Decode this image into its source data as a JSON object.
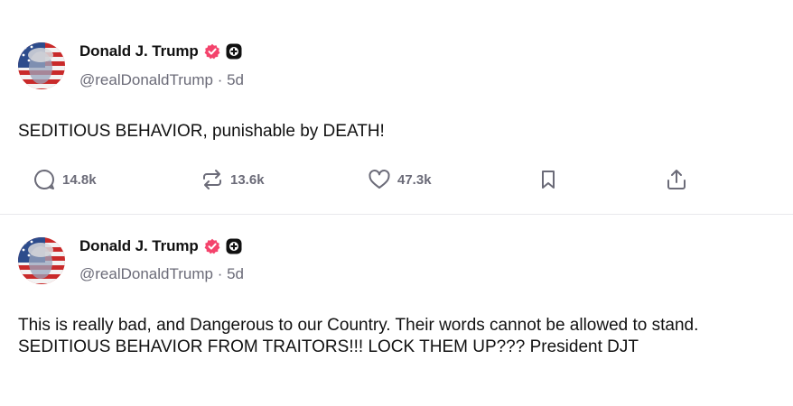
{
  "posts": [
    {
      "author": {
        "display_name": "Donald J. Trump",
        "handle": "@realDonaldTrump",
        "time": "5d",
        "separator": "·",
        "badges": [
          "verified-badge-icon",
          "plus-badge-icon"
        ]
      },
      "text": "SEDITIOUS BEHAVIOR, punishable by DEATH!",
      "actions": {
        "replies": "14.8k",
        "reposts": "13.6k",
        "likes": "47.3k"
      }
    },
    {
      "author": {
        "display_name": "Donald J. Trump",
        "handle": "@realDonaldTrump",
        "time": "5d",
        "separator": "·",
        "badges": [
          "verified-badge-icon",
          "plus-badge-icon"
        ]
      },
      "text_lines": [
        "This is really bad, and Dangerous to our Country. Their words cannot be allowed to stand.",
        "SEDITIOUS BEHAVIOR FROM TRAITORS!!! LOCK THEM UP??? President DJT"
      ]
    }
  ],
  "colors": {
    "verified": "#f4436c",
    "plus_badge": "#111111",
    "secondary_text": "#6b6b78",
    "divider": "#e9e9ec",
    "icon": "#6b6b78"
  }
}
